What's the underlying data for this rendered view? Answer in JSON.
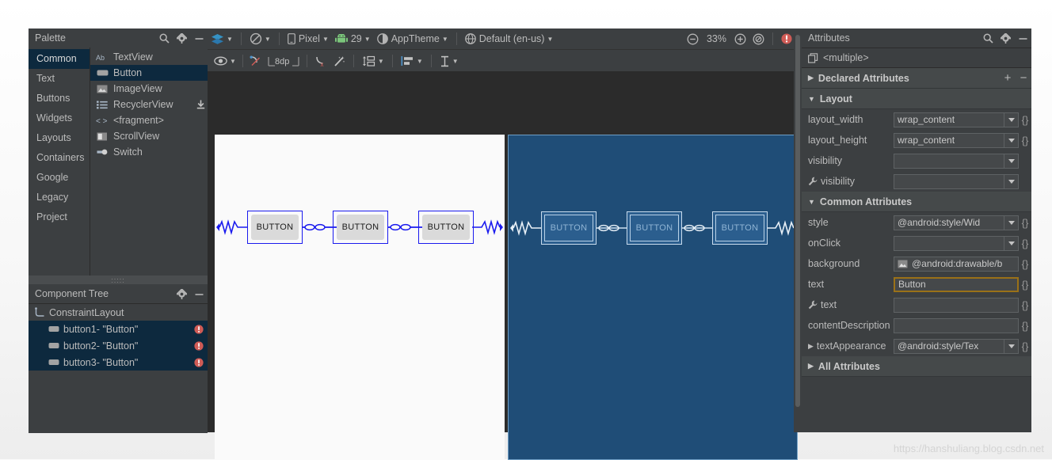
{
  "palette": {
    "title": "Palette",
    "categories": [
      {
        "label": "Common",
        "selected": true
      },
      {
        "label": "Text",
        "selected": false
      },
      {
        "label": "Buttons",
        "selected": false
      },
      {
        "label": "Widgets",
        "selected": false
      },
      {
        "label": "Layouts",
        "selected": false
      },
      {
        "label": "Containers",
        "selected": false
      },
      {
        "label": "Google",
        "selected": false
      },
      {
        "label": "Legacy",
        "selected": false
      },
      {
        "label": "Project",
        "selected": false
      }
    ],
    "items": [
      {
        "label": "TextView",
        "icon": "ab-text-icon",
        "selected": false,
        "download": false
      },
      {
        "label": "Button",
        "icon": "button-icon",
        "selected": true,
        "download": false
      },
      {
        "label": "ImageView",
        "icon": "image-icon",
        "selected": false,
        "download": false
      },
      {
        "label": "RecyclerView",
        "icon": "list-icon",
        "selected": false,
        "download": true
      },
      {
        "label": "<fragment>",
        "icon": "code-brackets-icon",
        "selected": false,
        "download": false
      },
      {
        "label": "ScrollView",
        "icon": "scrollview-icon",
        "selected": false,
        "download": false
      },
      {
        "label": "Switch",
        "icon": "switch-icon",
        "selected": false,
        "download": false
      }
    ]
  },
  "component_tree": {
    "title": "Component Tree",
    "rows": [
      {
        "label": "ConstraintLayout",
        "icon": "constraintlayout-icon",
        "selected": false,
        "error": false,
        "indent": false
      },
      {
        "label": "button1- \"Button\"",
        "icon": "button-icon",
        "selected": true,
        "error": true,
        "indent": true
      },
      {
        "label": "button2- \"Button\"",
        "icon": "button-icon",
        "selected": true,
        "error": true,
        "indent": true
      },
      {
        "label": "button3- \"Button\"",
        "icon": "button-icon",
        "selected": true,
        "error": true,
        "indent": true
      }
    ]
  },
  "toolbar_top": {
    "design_mode": "design-surface-icon",
    "orientation": "rotate-icon",
    "device": "Pixel",
    "api_level": "29",
    "theme": "AppTheme",
    "locale": "Default (en-us)",
    "zoom_out": "zoom-out-icon",
    "zoom_level": "33%",
    "zoom_in": "zoom-in-icon",
    "zoom_fit": "zoom-fit-icon",
    "error_badge": "error-icon"
  },
  "toolbar_design": {
    "view_options": "eye-icon",
    "clear_constraints": "clear-constraints-icon",
    "default_margin": "8dp",
    "remove_baseline": "baseline-off-icon",
    "infer_constraints": "magic-wand-icon",
    "pack": "pack-icon",
    "align": "align-icon",
    "guidelines": "guidelines-icon"
  },
  "canvas": {
    "design_buttons": [
      {
        "label": "BUTTON"
      },
      {
        "label": "BUTTON"
      },
      {
        "label": "BUTTON"
      }
    ],
    "blueprint_buttons": [
      {
        "label": "BUTTON"
      },
      {
        "label": "BUTTON"
      },
      {
        "label": "BUTTON"
      }
    ]
  },
  "attributes": {
    "title": "Attributes",
    "selection": "<multiple>",
    "sections": [
      {
        "label": "Declared Attributes",
        "expanded": false,
        "add": "+",
        "remove": "−"
      },
      {
        "label": "Layout",
        "expanded": true
      },
      {
        "label": "Common Attributes",
        "expanded": true
      },
      {
        "label": "All Attributes",
        "expanded": false
      }
    ],
    "layout_rows": [
      {
        "name": "layout_width",
        "value": "wrap_content",
        "dropdown": true,
        "brace": true,
        "wrench": false,
        "img": false,
        "focus": false,
        "expand": false
      },
      {
        "name": "layout_height",
        "value": "wrap_content",
        "dropdown": true,
        "brace": true,
        "wrench": false,
        "img": false,
        "focus": false,
        "expand": false
      },
      {
        "name": "visibility",
        "value": "",
        "dropdown": true,
        "brace": false,
        "wrench": false,
        "img": false,
        "focus": false,
        "expand": false
      },
      {
        "name": "visibility",
        "value": "",
        "dropdown": true,
        "brace": false,
        "wrench": true,
        "img": false,
        "focus": false,
        "expand": false
      }
    ],
    "common_rows": [
      {
        "name": "style",
        "value": "@android:style/Wid",
        "dropdown": true,
        "brace": true,
        "wrench": false,
        "img": false,
        "focus": false,
        "expand": false
      },
      {
        "name": "onClick",
        "value": "",
        "dropdown": true,
        "brace": true,
        "wrench": false,
        "img": false,
        "focus": false,
        "expand": false
      },
      {
        "name": "background",
        "value": "@android:drawable/b",
        "dropdown": false,
        "brace": true,
        "wrench": false,
        "img": true,
        "focus": false,
        "expand": false
      },
      {
        "name": "text",
        "value": "Button",
        "dropdown": false,
        "brace": true,
        "wrench": false,
        "img": false,
        "focus": true,
        "expand": false
      },
      {
        "name": "text",
        "value": "",
        "dropdown": false,
        "brace": true,
        "wrench": true,
        "img": false,
        "focus": false,
        "expand": false
      },
      {
        "name": "contentDescription",
        "value": "",
        "dropdown": false,
        "brace": true,
        "wrench": false,
        "img": false,
        "focus": false,
        "expand": false
      },
      {
        "name": "textAppearance",
        "value": "@android:style/Tex",
        "dropdown": true,
        "brace": true,
        "wrench": false,
        "img": false,
        "focus": false,
        "expand": true
      }
    ]
  },
  "watermark": "https://hanshuliang.blog.csdn.net",
  "colors": {
    "panel_bg": "#3c3f41",
    "selection_bg": "#0d293e",
    "canvas_bg": "#2b2b2b",
    "blueprint_bg": "#1f4d77",
    "constraint_blue": "#1a1aee",
    "error_red": "#cf5b56",
    "focus_gold": "#9a7118"
  }
}
